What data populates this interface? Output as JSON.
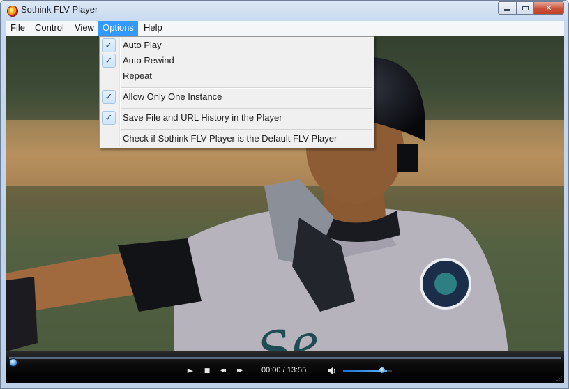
{
  "window": {
    "title": "Sothink FLV Player",
    "icon": "sothink-app-icon"
  },
  "window_controls": {
    "minimize_icon": "minimize-icon",
    "maximize_icon": "maximize-icon",
    "close_glyph": "✕"
  },
  "menubar": {
    "items": [
      "File",
      "Control",
      "View",
      "Options",
      "Help"
    ],
    "active": "Options"
  },
  "options_menu": {
    "items": [
      {
        "label": "Auto Play",
        "checked": true
      },
      {
        "label": "Auto Rewind",
        "checked": true
      },
      {
        "label": "Repeat",
        "checked": false
      },
      {
        "label": "Allow Only One Instance",
        "checked": true
      },
      {
        "label": "Save File and URL History in the Player",
        "checked": true
      },
      {
        "label": "Check if Sothink FLV Player is the Default FLV Player",
        "checked": false
      }
    ],
    "check_glyph": "✓"
  },
  "player": {
    "time_display": "00:00 / 13:55",
    "seek_progress": 0,
    "volume_level": 0.9,
    "buttons": {
      "play": "►",
      "stop": "■",
      "rewind": "◂◂",
      "forward": "▸▸"
    }
  },
  "colors": {
    "menu_highlight": "#3399ff",
    "accent_blue": "#3c8ee6",
    "controls_bg": "#0c0c0c"
  }
}
